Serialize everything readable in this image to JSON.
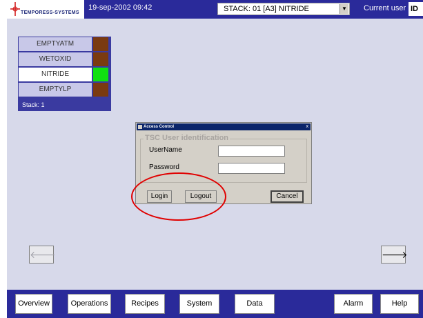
{
  "header": {
    "logo_text": "TEMPORESS-SYSTEMS",
    "datetime": "19-sep-2002 09:42",
    "stack_select": "STACK: 01 [A3] NITRIDE",
    "current_user_label": "Current user",
    "current_user_value": "ID"
  },
  "stack_panel": {
    "rows": [
      {
        "label": "EMPTYATM",
        "color": "#7a3a10"
      },
      {
        "label": "WETOXID",
        "color": "#7a3a10"
      },
      {
        "label": "NITRIDE",
        "color": "#10e010"
      },
      {
        "label": "EMPTYLP",
        "color": "#7a3a10"
      }
    ],
    "active_index": 2,
    "footer": "Stack: 1"
  },
  "dialog": {
    "title": "Access Control",
    "close": "x",
    "group_title": "TSC User identification",
    "username_label": "UserName",
    "password_label": "Password",
    "username_value": "",
    "password_value": "",
    "login": "Login",
    "logout": "Logout",
    "cancel": "Cancel"
  },
  "nav": {
    "prev_icon": "left-arrow-icon",
    "next_icon": "right-arrow-icon"
  },
  "bottom": {
    "overview": "Overview",
    "operations": "Operations",
    "recipes": "Recipes",
    "system": "System",
    "data": "Data",
    "alarm": "Alarm",
    "help": "Help"
  },
  "colors": {
    "bar": "#2a2a9a",
    "background": "#d7d9ea",
    "highlight_ring": "#e00000"
  }
}
